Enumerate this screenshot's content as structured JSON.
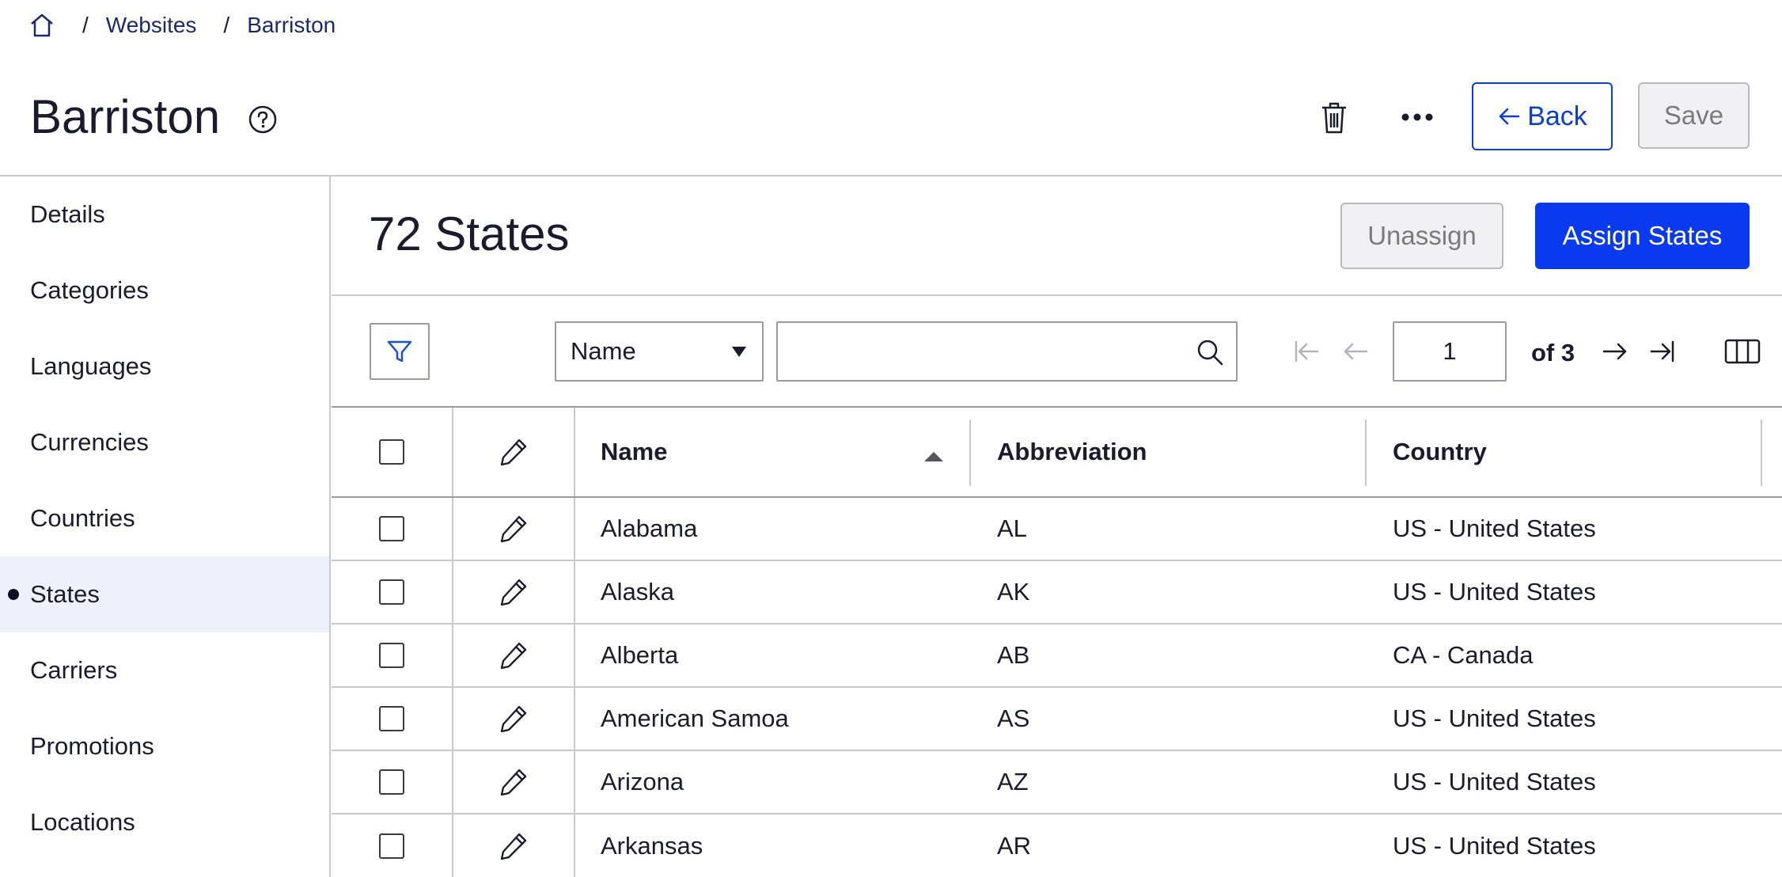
{
  "breadcrumb": {
    "items": [
      "Websites",
      "Barriston"
    ]
  },
  "header": {
    "title": "Barriston",
    "back_label": "Back",
    "save_label": "Save"
  },
  "sidebar": {
    "items": [
      {
        "label": "Details"
      },
      {
        "label": "Categories"
      },
      {
        "label": "Languages"
      },
      {
        "label": "Currencies"
      },
      {
        "label": "Countries"
      },
      {
        "label": "States",
        "active": true
      },
      {
        "label": "Carriers"
      },
      {
        "label": "Promotions"
      },
      {
        "label": "Locations"
      }
    ]
  },
  "main": {
    "title": "72 States",
    "unassign_label": "Unassign",
    "assign_label": "Assign States"
  },
  "toolbar": {
    "search_field": "Name",
    "search_value": "",
    "current_page": "1",
    "page_of": "of 3"
  },
  "table": {
    "columns": {
      "name": "Name",
      "abbreviation": "Abbreviation",
      "country": "Country"
    },
    "sort": {
      "column": "Name",
      "direction": "ascending"
    },
    "rows": [
      {
        "name": "Alabama",
        "abbreviation": "AL",
        "country": "US - United States"
      },
      {
        "name": "Alaska",
        "abbreviation": "AK",
        "country": "US - United States"
      },
      {
        "name": "Alberta",
        "abbreviation": "AB",
        "country": "CA - Canada"
      },
      {
        "name": "American Samoa",
        "abbreviation": "AS",
        "country": "US - United States"
      },
      {
        "name": "Arizona",
        "abbreviation": "AZ",
        "country": "US - United States"
      },
      {
        "name": "Arkansas",
        "abbreviation": "AR",
        "country": "US - United States"
      }
    ]
  },
  "colors": {
    "primary": "#0a3af0",
    "link": "#1b2a6b",
    "active_bg": "#eef0fb",
    "disabled_bg": "#f1f1f3"
  },
  "icons": [
    "home-icon",
    "help-icon",
    "trash-icon",
    "more-icon",
    "arrow-left-icon",
    "filter-icon",
    "chevron-down-icon",
    "search-icon",
    "first-page-icon",
    "prev-page-icon",
    "next-page-icon",
    "last-page-icon",
    "columns-icon",
    "edit-icon",
    "sort-asc-icon"
  ]
}
